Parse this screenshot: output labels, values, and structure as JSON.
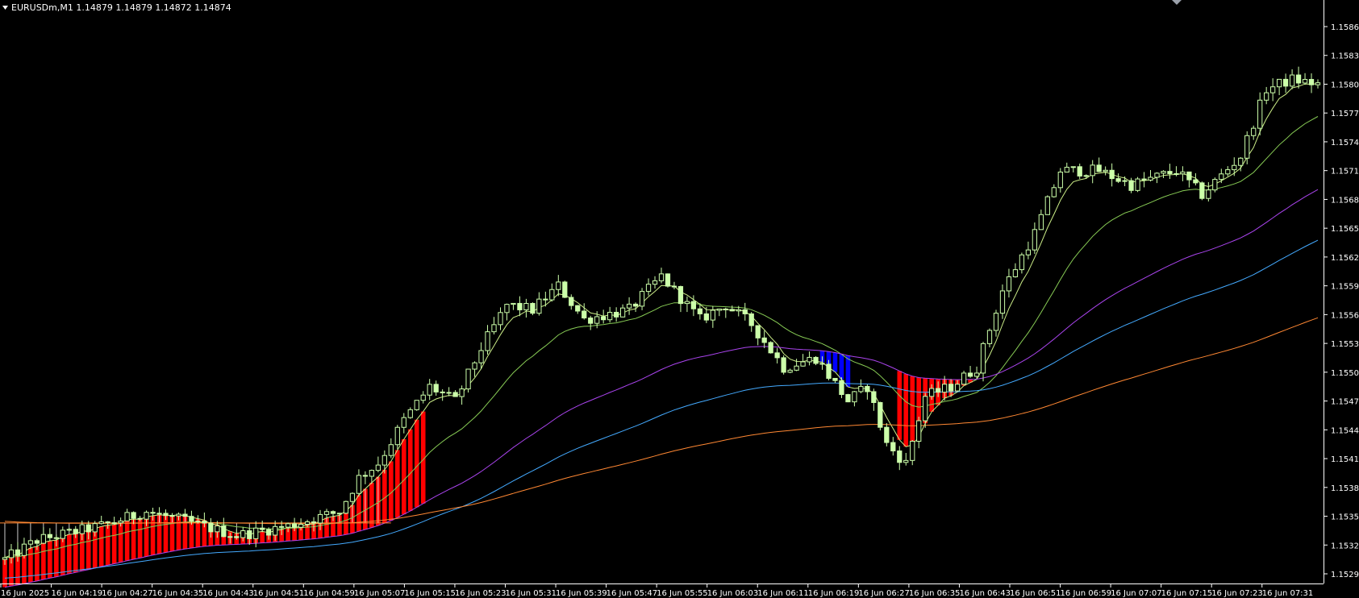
{
  "chart_data": {
    "type": "candlestick",
    "title": "EURUSDm,M1  1.14879 1.14879 1.14872 1.14874",
    "symbol": "EURUSDm",
    "timeframe": "M1",
    "quote": {
      "open": "1.14879",
      "high": "1.14879",
      "low": "1.14872",
      "close": "1.14874"
    },
    "ylim": [
      1.1528,
      1.1588
    ],
    "yticks": [
      "1.15865",
      "1.15835",
      "1.15805",
      "1.15775",
      "1.15745",
      "1.15715",
      "1.15685",
      "1.15655",
      "1.15625",
      "1.15595",
      "1.15565",
      "1.15535",
      "1.15505",
      "1.15475",
      "1.15445",
      "1.15415",
      "1.15385",
      "1.15355",
      "1.15325",
      "1.15295"
    ],
    "xticks": [
      "16 Jun 2025",
      "16 Jun 04:19",
      "16 Jun 04:27",
      "16 Jun 04:35",
      "16 Jun 04:43",
      "16 Jun 04:51",
      "16 Jun 04:59",
      "16 Jun 05:07",
      "16 Jun 05:15",
      "16 Jun 05:23",
      "16 Jun 05:31",
      "16 Jun 05:39",
      "16 Jun 05:47",
      "16 Jun 05:55",
      "16 Jun 06:03",
      "16 Jun 06:11",
      "16 Jun 06:19",
      "16 Jun 06:27",
      "16 Jun 06:35",
      "16 Jun 06:43",
      "16 Jun 06:51",
      "16 Jun 06:59",
      "16 Jun 07:07",
      "16 Jun 07:15",
      "16 Jun 07:23",
      "16 Jun 07:31"
    ],
    "price_anchors": [
      [
        0,
        1.1531
      ],
      [
        5,
        1.1533
      ],
      [
        15,
        1.15345
      ],
      [
        22,
        1.1536
      ],
      [
        28,
        1.1535
      ],
      [
        36,
        1.15335
      ],
      [
        44,
        1.15345
      ],
      [
        52,
        1.1536
      ],
      [
        55,
        1.15395
      ],
      [
        58,
        1.1541
      ],
      [
        62,
        1.15455
      ],
      [
        66,
        1.1549
      ],
      [
        70,
        1.15475
      ],
      [
        74,
        1.1553
      ],
      [
        78,
        1.15575
      ],
      [
        82,
        1.1557
      ],
      [
        86,
        1.15595
      ],
      [
        90,
        1.1556
      ],
      [
        97,
        1.1557
      ],
      [
        102,
        1.15605
      ],
      [
        108,
        1.1556
      ],
      [
        112,
        1.15575
      ],
      [
        116,
        1.15555
      ],
      [
        121,
        1.1551
      ],
      [
        126,
        1.1552
      ],
      [
        131,
        1.15475
      ],
      [
        134,
        1.1549
      ],
      [
        137,
        1.1543
      ],
      [
        140,
        1.1541
      ],
      [
        143,
        1.1548
      ],
      [
        147,
        1.1549
      ],
      [
        151,
        1.1551
      ],
      [
        155,
        1.1559
      ],
      [
        160,
        1.1565
      ],
      [
        164,
        1.15715
      ],
      [
        170,
        1.15715
      ],
      [
        175,
        1.157
      ],
      [
        182,
        1.15715
      ],
      [
        186,
        1.1569
      ],
      [
        192,
        1.1573
      ],
      [
        196,
        1.158
      ],
      [
        200,
        1.1581
      ],
      [
        204,
        1.15805
      ]
    ],
    "candle_count": 205,
    "series": [
      {
        "name": "",
        "type": "ema",
        "period": 5,
        "color": "#ccee88"
      },
      {
        "name": "",
        "type": "ema",
        "period": 20,
        "color": "#88cc55"
      },
      {
        "name": "",
        "type": "ema",
        "period": 60,
        "color": "#aa44ee"
      },
      {
        "name": "",
        "type": "ema",
        "period": 100,
        "color": "#44aaff"
      },
      {
        "name": "",
        "type": "ema",
        "period": 200,
        "color": "#ff8833"
      }
    ],
    "up_color": "#ccffaa",
    "down_color": "#ccffaa",
    "band_fill_colors": [
      "#ff0000",
      "#0000ff"
    ],
    "grid": false,
    "legend": "none"
  },
  "colors": {
    "background": "#000000",
    "axis": "#ffffff",
    "text": "#ffffff"
  },
  "icons": {
    "title_marker": "triangle-down-icon",
    "shift_marker": "triangle-shift-icon"
  }
}
